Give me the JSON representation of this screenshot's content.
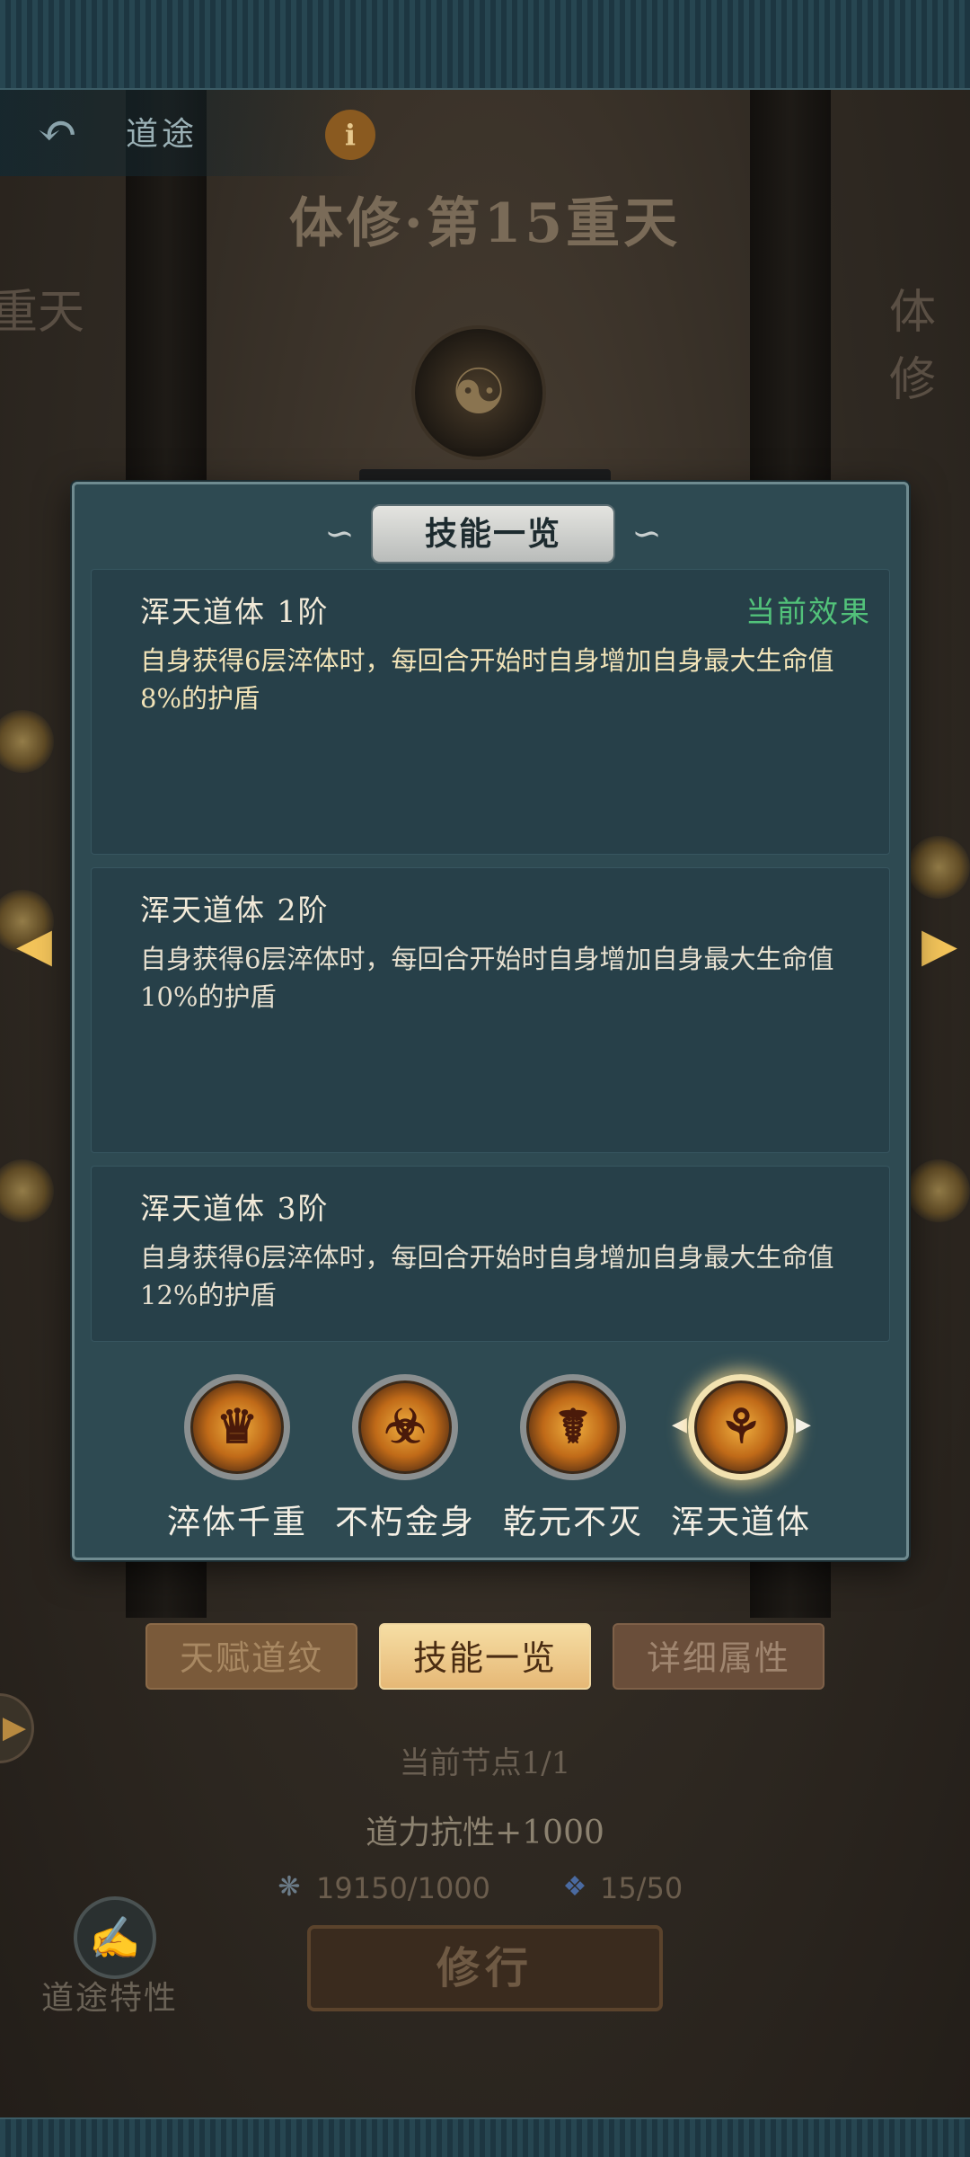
{
  "nav": {
    "title": "道途"
  },
  "realm": {
    "title": "体修·第15重天",
    "side_left": "重天",
    "side_right": "体修"
  },
  "dialog": {
    "title": "技能一览",
    "tiers": [
      {
        "name": "浑天道体 1阶",
        "status": "当前效果",
        "desc": "自身获得6层淬体时，每回合开始时自身增加自身最大生命值8%的护盾"
      },
      {
        "name": "浑天道体 2阶",
        "desc": "自身获得6层淬体时，每回合开始时自身增加自身最大生命值10%的护盾"
      },
      {
        "name": "浑天道体 3阶",
        "desc": "自身获得6层淬体时，每回合开始时自身增加自身最大生命值12%的护盾"
      }
    ],
    "skills": [
      {
        "label": "淬体千重",
        "icon": "golden-idol-icon",
        "active": false
      },
      {
        "label": "不朽金身",
        "icon": "demon-mask-icon",
        "active": false
      },
      {
        "label": "乾元不灭",
        "icon": "horned-demon-icon",
        "active": false
      },
      {
        "label": "浑天道体",
        "icon": "armored-demon-icon",
        "active": true
      }
    ]
  },
  "tabs": {
    "talent": "天赋道纹",
    "skills": "技能一览",
    "attributes": "详细属性"
  },
  "progress": {
    "node": "当前节点1/1",
    "bonus": "道力抗性+1000",
    "res1": "19150/1000",
    "res2": "15/50"
  },
  "actions": {
    "practice": "修行",
    "traits": "道途特性"
  },
  "colors": {
    "status_green": "#52c27a",
    "dialog_bg": "#2e4a52",
    "active_tab": "#f6dea4"
  }
}
